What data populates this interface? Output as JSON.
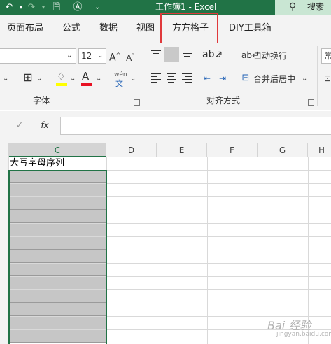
{
  "titlebar": {
    "title": "工作簿1  -  Excel",
    "search_label": "搜索",
    "bg_color": "#217346"
  },
  "tabs": [
    {
      "label": "页面布局"
    },
    {
      "label": "公式"
    },
    {
      "label": "数据"
    },
    {
      "label": "视图"
    },
    {
      "label": "方方格子"
    },
    {
      "label": "DIY工具箱"
    }
  ],
  "ribbon": {
    "font_size_value": "12",
    "font_group_label": "字体",
    "alignment_group_label": "对齐方式",
    "wrap_text_label": "自动换行",
    "merge_center_label": "合并后居中",
    "phonetic_label": "wén",
    "phonetic_char": "文",
    "bold_A": "A",
    "overflow_label": "常"
  },
  "formula_bar": {
    "fx_label": "fx",
    "value": ""
  },
  "sheet": {
    "columns": [
      "C",
      "D",
      "E",
      "F",
      "G",
      "H"
    ],
    "selected_column": "C",
    "c1_value": "大写字母序列",
    "selection_fill": "#c6c6c6",
    "accent": "#217346"
  },
  "watermark": {
    "brand": "Bai 经验",
    "sub": "jingyan.baidu.com"
  }
}
